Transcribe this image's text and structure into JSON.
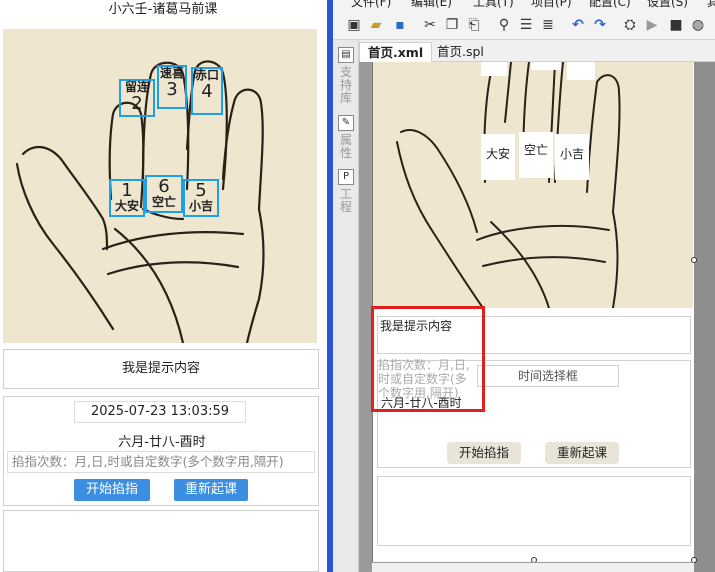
{
  "preview": {
    "title": "小六壬-诸葛马前课",
    "palm_cells": [
      {
        "name": "留连",
        "num": "2"
      },
      {
        "name": "速喜",
        "num": "3"
      },
      {
        "name": "赤口",
        "num": "4"
      },
      {
        "name": "大安",
        "num": "1"
      },
      {
        "name": "空亡",
        "num": "6"
      },
      {
        "name": "小吉",
        "num": "5"
      }
    ],
    "tip_text": "我是提示内容",
    "datetime_value": "2025-07-23 13:03:59",
    "lunar_text": "六月-廿八-酉时",
    "count_placeholder": "掐指次数：月,日,时或自定数字(多个数字用,隔开)",
    "start_button": "开始掐指",
    "restart_button": "重新起课"
  },
  "ide": {
    "menu": [
      "文件(F)",
      "编辑(E)",
      "工具(T)",
      "项目(P)",
      "配置(C)",
      "设置(S)",
      "其"
    ],
    "sidebar_tabs": [
      {
        "icon": "▤",
        "label": "支持库"
      },
      {
        "icon": "✎",
        "label": "属性"
      },
      {
        "icon": "P",
        "label": "工程"
      }
    ],
    "file_tabs": [
      "首页.xml",
      "首页.spl"
    ],
    "palm_labels": [
      "大安",
      "空亡",
      "小吉"
    ],
    "tip_text": "我是提示内容",
    "count_placeholder": "掐指次数：月,日,时或自定数字(多个数字用,隔开)",
    "lunar_text": "六月-廿八-酉时",
    "time_picker": "时间选择框",
    "start_button": "开始掐指",
    "restart_button": "重新起课"
  }
}
